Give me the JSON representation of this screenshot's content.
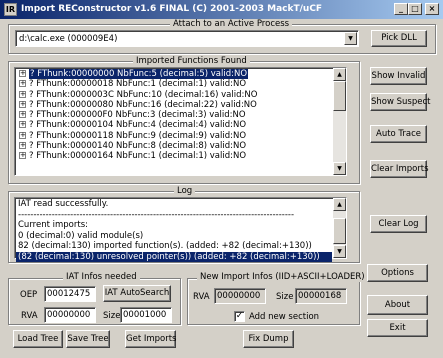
{
  "window": {
    "title": "Import REConstructor v1.6 FINAL (C) 2001-2003 MackT/uCF",
    "app_icon": "IR",
    "minimize": "_",
    "maximize": "□",
    "close": "×"
  },
  "attach": {
    "frame_label": "Attach to an Active Process",
    "process_value": "d:\\calc.exe (000009E4)",
    "dropdown_arrow": "▼",
    "pick_dll": "Pick DLL"
  },
  "imports": {
    "frame_label": "Imported Functions Found",
    "items": [
      {
        "text": "? FThunk:00000000 NbFunc:5 (decimal:5) valid:NO",
        "selected": true
      },
      {
        "text": "? FThunk:00000018 NbFunc:1 (decimal:1) valid:NO"
      },
      {
        "text": "? FThunk:0000003C NbFunc:10 (decimal:16) valid:NO"
      },
      {
        "text": "? FThunk:00000080 NbFunc:16 (decimal:22) valid:NO"
      },
      {
        "text": "? FThunk:000000F0 NbFunc:3 (decimal:3) valid:NO"
      },
      {
        "text": "? FThunk:00000104 NbFunc:4 (decimal:4) valid:NO"
      },
      {
        "text": "? FThunk:00000118 NbFunc:9 (decimal:9) valid:NO"
      },
      {
        "text": "? FThunk:00000140 NbFunc:8 (decimal:8) valid:NO"
      },
      {
        "text": "? FThunk:00000164 NbFunc:1 (decimal:1) valid:NO"
      }
    ],
    "expand_glyph": "+",
    "scroll_up": "▲",
    "scroll_down": "▼"
  },
  "side_buttons": {
    "show_invalid": "Show Invalid",
    "show_suspect": "Show Suspect",
    "auto_trace": "Auto Trace",
    "clear_imports": "Clear Imports",
    "clear_log": "Clear Log",
    "options": "Options",
    "about": "About",
    "exit": "Exit"
  },
  "log": {
    "frame_label": "Log",
    "lines": [
      {
        "text": "IAT read successfully."
      },
      {
        "text": "------------------------------------------------------------------------------------------"
      },
      {
        "text": "Current imports:"
      },
      {
        "text": "0 (decimal:0) valid module(s)"
      },
      {
        "text": "82 (decimal:130) imported function(s). (added: +82 (decimal:+130))"
      },
      {
        "text": "(82 (decimal:130) unresolved pointer(s)) (added: +82 (decimal:+130))",
        "selected": true
      }
    ],
    "scroll_up": "▲",
    "scroll_down": "▼"
  },
  "iat": {
    "frame_label": "IAT Infos needed",
    "oep_label": "OEP",
    "oep_value": "00012475",
    "autosearch": "IAT AutoSearch",
    "rva_label": "RVA",
    "rva_value": "00000000",
    "size_label": "Size",
    "size_value": "00001000"
  },
  "new_import": {
    "frame_label": "New Import Infos (IID+ASCII+LOADER)",
    "rva_label": "RVA",
    "rva_value": "00000000",
    "size_label": "Size",
    "size_value": "00000168",
    "add_section_label": "Add new section",
    "add_section_checked": true,
    "check_glyph": "✓"
  },
  "bottom_buttons": {
    "load_tree": "Load Tree",
    "save_tree": "Save Tree",
    "get_imports": "Get Imports",
    "fix_dump": "Fix Dump"
  }
}
